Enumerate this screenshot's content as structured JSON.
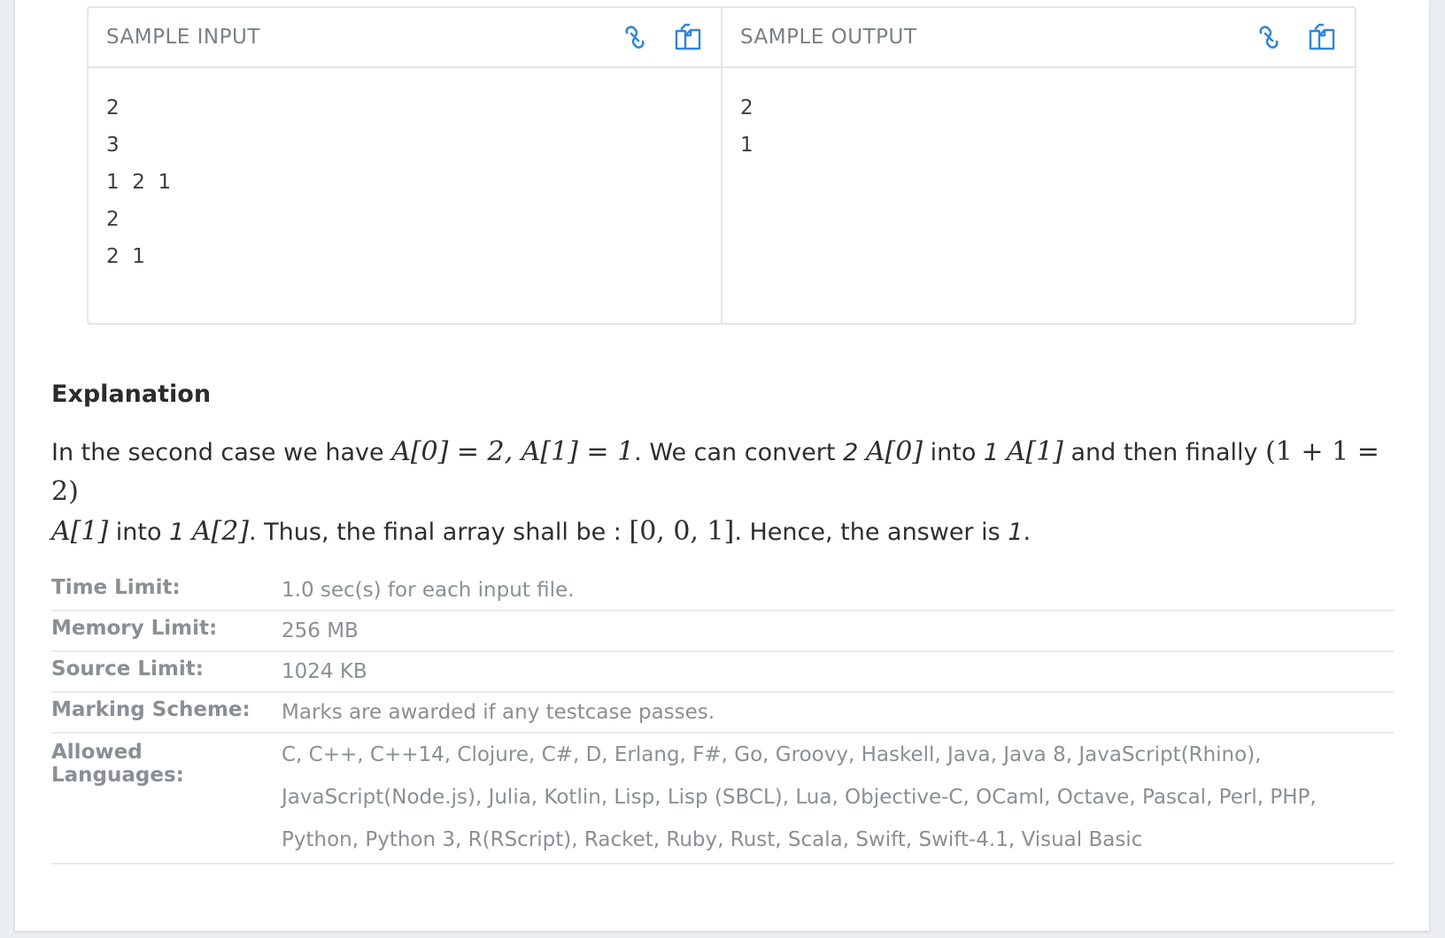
{
  "samples": {
    "input": {
      "title": "SAMPLE INPUT",
      "lines": [
        "2",
        "3",
        "1  2  1",
        "2",
        "2  1"
      ]
    },
    "output": {
      "title": "SAMPLE OUTPUT",
      "lines": [
        "2",
        "1"
      ]
    }
  },
  "explanation": {
    "title": "Explanation",
    "parts": {
      "t1": "In the second case we have ",
      "m1": "A[0] = 2, A[1] = 1",
      "t2": ". We can convert ",
      "i1": "2",
      "m2": "A[0]",
      "t3": " into ",
      "i2": "1",
      "m3": "A[1]",
      "t4": " and then finally ",
      "m4": "(1 + 1 = 2)",
      "m5": "A[1]",
      "t5": " into ",
      "i3": "1",
      "m6": "A[2]",
      "t6": ". Thus, the final array shall be : ",
      "m7": "[0, 0, 1]",
      "t7": ". Hence, the answer is ",
      "i4": "1",
      "t8": "."
    }
  },
  "limits": {
    "time": {
      "label": "Time Limit:",
      "value": "1.0 sec(s) for each input file."
    },
    "memory": {
      "label": "Memory Limit:",
      "value": "256 MB"
    },
    "source": {
      "label": "Source Limit:",
      "value": "1024 KB"
    },
    "marking": {
      "label": "Marking Scheme:",
      "value": "Marks are awarded if any testcase passes."
    },
    "languages": {
      "label": "Allowed Languages:",
      "value": "C, C++, C++14, Clojure, C#, D, Erlang, F#, Go, Groovy, Haskell, Java, Java 8, JavaScript(Rhino), JavaScript(Node.js), Julia, Kotlin, Lisp, Lisp (SBCL), Lua, Objective-C, OCaml, Octave, Pascal, Perl, PHP, Python, Python 3, R(RScript), Racket, Ruby, Rust, Scala, Swift, Swift-4.1, Visual Basic"
    }
  },
  "colors": {
    "accent": "#2e86de",
    "border": "#e2e5e8",
    "muted": "#8a8f94"
  },
  "icons": [
    "link-icon",
    "copy-icon"
  ]
}
